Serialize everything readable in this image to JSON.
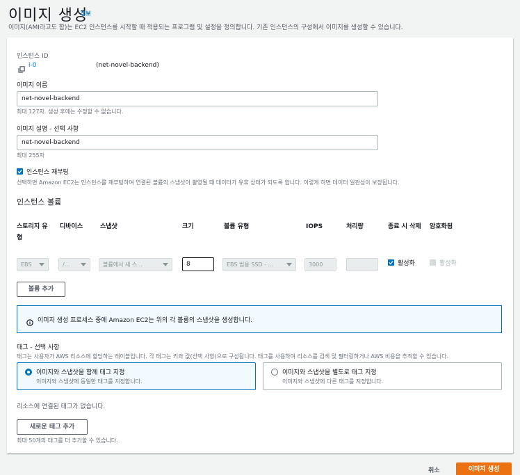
{
  "page": {
    "title": "이미지 생성",
    "info_link": "정보",
    "description": "이미지(AMI라고도 함)는 EC2 인스턴스를 시작할 때 적용되는 프로그램 및 설정을 정의합니다. 기존 인스턴스의 구성에서 이미지를 생성할 수 있습니다."
  },
  "instance": {
    "label": "인스턴스 ID",
    "id": "i-0",
    "name": "(net-novel-backend)"
  },
  "image_name": {
    "label": "이미지 이름",
    "value": "net-novel-backend",
    "constraint": "최대 127자. 생성 후에는 수정할 수 없습니다."
  },
  "image_description": {
    "label": "이미지 설명 - 선택 사항",
    "value": "net-novel-backend",
    "constraint": "최대 255자"
  },
  "reboot": {
    "label": "인스턴스 재부팅",
    "checked": true,
    "help": "선택하면 Amazon EC2는 인스턴스를 재부팅하여 연결된 볼륨의 스냅샷이 촬영될 때 데이터가 유휴 상태가 되도록 합니다. 이렇게 하면 데이터 일관성이 보장됩니다."
  },
  "volumes": {
    "title": "인스턴스 볼륨",
    "headers": {
      "storage_type": "스토리지 유형",
      "device": "디바이스",
      "snapshot": "스냅샷",
      "size": "크기",
      "volume_type": "볼륨 유형",
      "iops": "IOPS",
      "throughput": "처리량",
      "delete_on_termination": "종료 시 삭제",
      "encryption": "암호화됨"
    },
    "row": {
      "storage_type": "EBS",
      "device": "/...",
      "snapshot": "볼륨에서 새 스...",
      "size": "8",
      "volume_type": "EBS 범용 SSD - ...",
      "iops": "3000",
      "throughput": "",
      "delete_on_termination": "활성화",
      "encryption": "활성화"
    },
    "add_button": "볼륨 추가"
  },
  "alert": {
    "text": "이미지 생성 프로세스 중에 Amazon EC2는 위의 각 볼륨의 스냅샷을 생성합니다."
  },
  "tags": {
    "title": "태그 - 선택 사항",
    "description": "태그는 사용자가 AWS 리소스에 할당하는 레이블입니다. 각 태그는 키와 값(선택 사항)으로 구성됩니다. 태그를 사용하여 리소스를 검색 및 필터링하거나 AWS 비용을 추적할 수 있습니다.",
    "option_together_title": "이미지와 스냅샷을 함께 태그 지정",
    "option_together_desc": "이미지와 스냅샷에 동일한 태그를 지정합니다.",
    "option_separate_title": "이미지와 스냅샷을 별도로 태그 지정",
    "option_separate_desc": "이미지와 스냅샷에 다른 태그를 지정합니다.",
    "empty_text": "리소스에 연결된 태그가 없습니다.",
    "add_button": "새로운 태그 추가",
    "limit_text": "최대 50개의 태그를 더 추가할 수 있습니다."
  },
  "footer": {
    "cancel": "취소",
    "create": "이미지 생성"
  }
}
